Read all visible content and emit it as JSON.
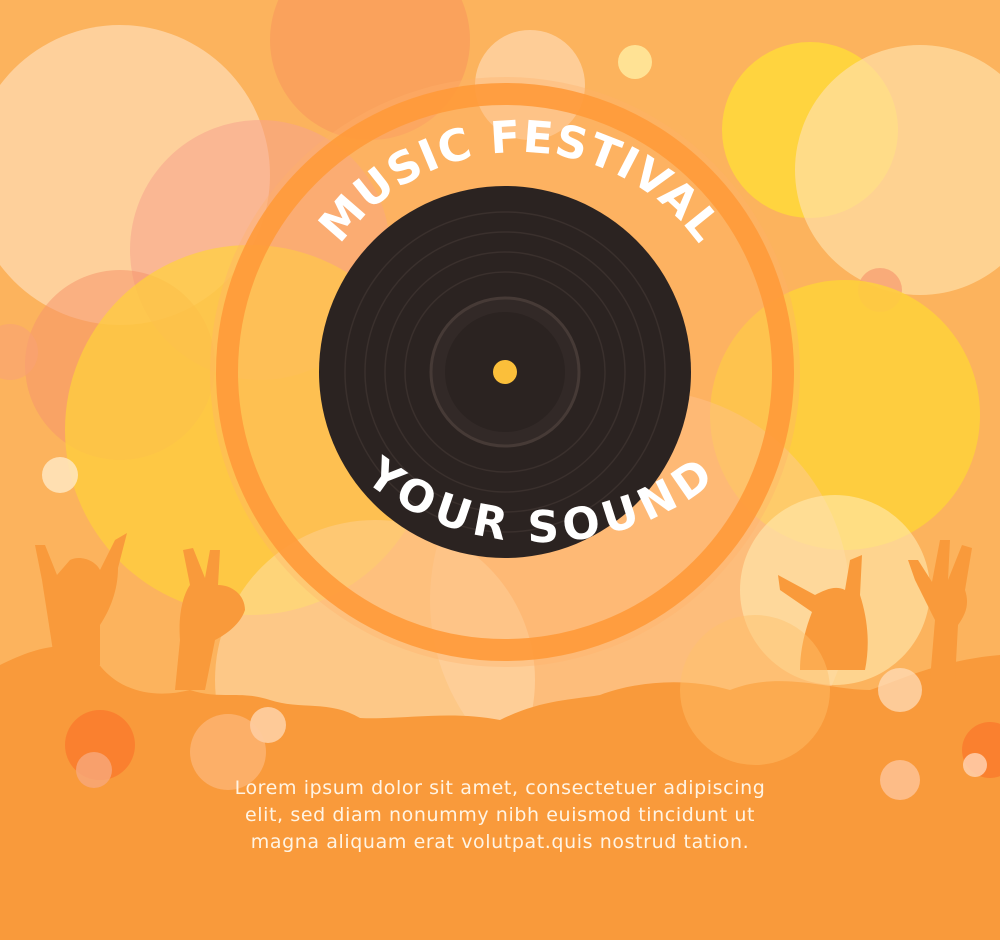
{
  "poster": {
    "title": "MUSIC FESTIVAL",
    "subtitle": "YOUR SOUND",
    "body_lines": [
      "Lorem ipsum dolor sit amet, consectetuer adipiscing",
      "elit, sed diam nonummy nibh euismod tincidunt ut",
      "magna aliquam erat volutpat.quis nostrud tation."
    ]
  },
  "colors": {
    "background": "#fcb35d",
    "ring": "#ff9a3a",
    "crowd": "#f99a3b",
    "record": "#2b2321",
    "record_center": "#fbbf3a",
    "text": "#ffffff"
  }
}
